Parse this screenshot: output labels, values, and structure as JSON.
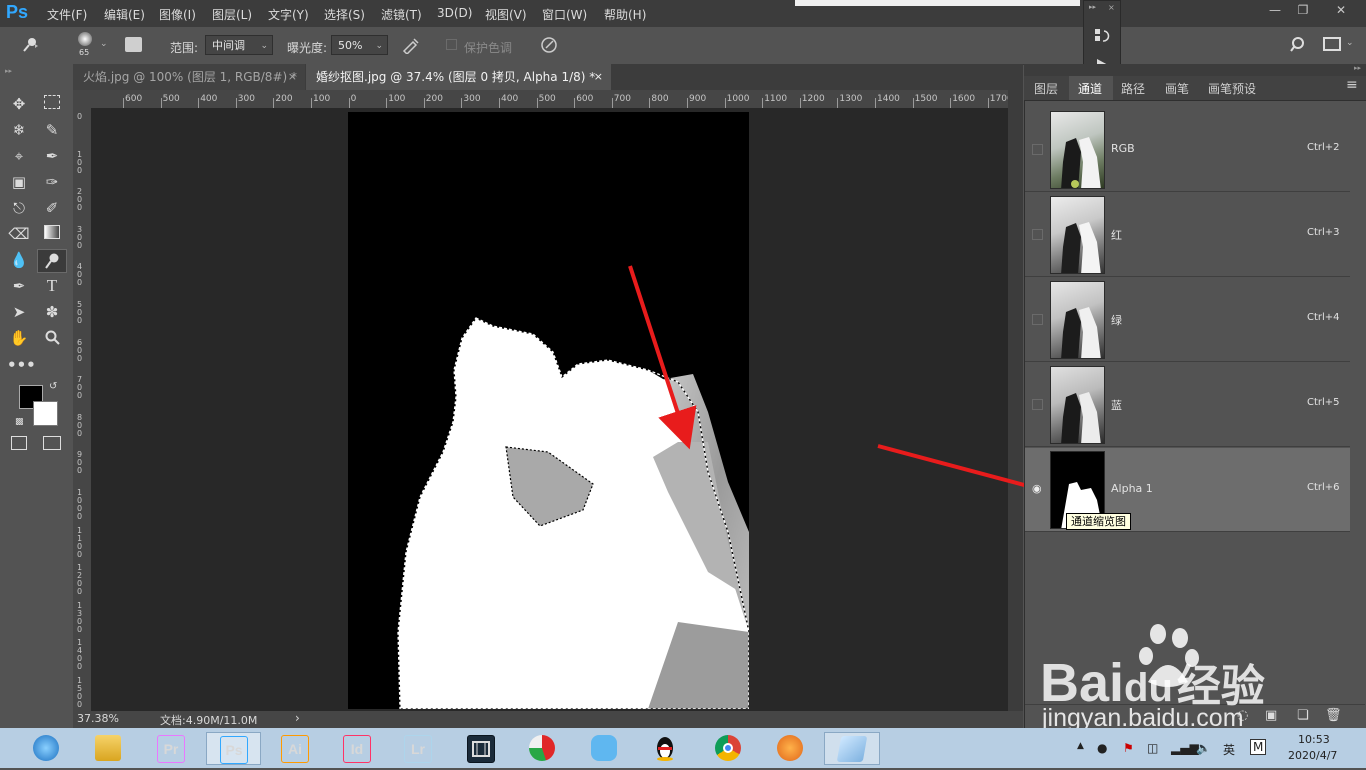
{
  "app": {
    "logo": "Ps"
  },
  "menu": [
    "文件(F)",
    "编辑(E)",
    "图像(I)",
    "图层(L)",
    "文字(Y)",
    "选择(S)",
    "滤镜(T)",
    "3D(D)",
    "视图(V)",
    "窗口(W)",
    "帮助(H)"
  ],
  "options": {
    "brush_size": "65",
    "range_label": "范围:",
    "range_value": "中间调",
    "exposure_label": "曝光度:",
    "exposure_value": "50%",
    "protect_tones": "保护色调"
  },
  "tabs": [
    {
      "label": "火焰.jpg @ 100% (图层 1, RGB/8#) *",
      "close": "×",
      "active": false
    },
    {
      "label": "婚纱抠图.jpg @ 37.4% (图层 0 拷贝, Alpha 1/8) *",
      "close": "×",
      "active": true
    }
  ],
  "ruler": {
    "h_ticks": [
      "600",
      "500",
      "400",
      "300",
      "200",
      "100",
      "0",
      "100",
      "200",
      "300",
      "400",
      "500",
      "600",
      "700",
      "800",
      "900",
      "1000",
      "1100",
      "1200",
      "1300",
      "1400",
      "1500",
      "1600",
      "1700"
    ],
    "v_ticks": [
      "0",
      "1 0 0",
      "2 0 0",
      "3 0 0",
      "4 0 0",
      "5 0 0",
      "6 0 0",
      "7 0 0",
      "8 0 0",
      "9 0 0",
      "1 0 0 0",
      "1 1 0 0",
      "1 2 0 0",
      "1 3 0 0",
      "1 4 0 0",
      "1 5 0 0"
    ]
  },
  "status": {
    "zoom": "37.38%",
    "doc_info": "文档:4.90M/11.0M",
    "arrow": "›"
  },
  "panel": {
    "tabs": [
      "图层",
      "通道",
      "路径",
      "画笔",
      "画笔预设"
    ],
    "active_tab": "通道",
    "channels": [
      {
        "name": "RGB",
        "shortcut": "Ctrl+2"
      },
      {
        "name": "红",
        "shortcut": "Ctrl+3"
      },
      {
        "name": "绿",
        "shortcut": "Ctrl+4"
      },
      {
        "name": "蓝",
        "shortcut": "Ctrl+5"
      },
      {
        "name": "Alpha 1",
        "shortcut": "Ctrl+6"
      }
    ],
    "tooltip": "通道缩览图"
  },
  "taskbar": {
    "apps": [
      {
        "name": "browser",
        "label": ""
      },
      {
        "name": "explorer",
        "label": ""
      },
      {
        "name": "premiere",
        "label": "Pr",
        "color": "#ea77ff",
        "bg": "#2a0d36"
      },
      {
        "name": "photoshop",
        "label": "Ps",
        "color": "#31a8ff",
        "bg": "#001e36"
      },
      {
        "name": "illustrator",
        "label": "Ai",
        "color": "#ff9a00",
        "bg": "#330000"
      },
      {
        "name": "indesign",
        "label": "Id",
        "color": "#ff3366",
        "bg": "#49021f"
      },
      {
        "name": "lightroom",
        "label": "Lr",
        "color": "#add5ec",
        "bg": "#001a2a"
      },
      {
        "name": "video-editor",
        "label": ""
      },
      {
        "name": "app-red-green",
        "label": ""
      },
      {
        "name": "app-blue-bird",
        "label": ""
      },
      {
        "name": "qq",
        "label": ""
      },
      {
        "name": "chrome",
        "label": ""
      },
      {
        "name": "app-orange",
        "label": ""
      },
      {
        "name": "notepad",
        "label": ""
      }
    ],
    "ime": "英",
    "ime_mode": "M",
    "time": "10:53",
    "date": "2020/4/7"
  },
  "watermark": {
    "brand": "Bai",
    "brand_suffix": "du",
    "brand_cn": "经验",
    "url": "jingyan.baidu.com"
  }
}
